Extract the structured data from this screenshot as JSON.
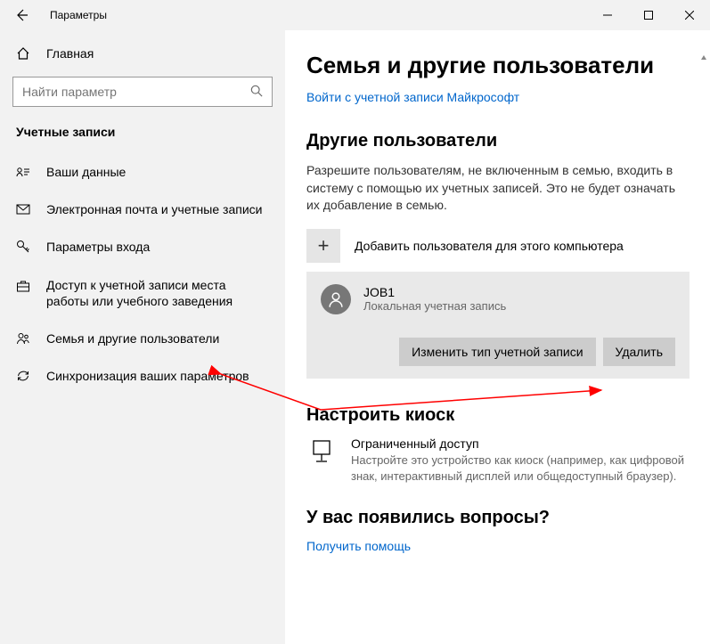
{
  "window": {
    "title": "Параметры"
  },
  "sidebar": {
    "home": "Главная",
    "searchPlaceholder": "Найти параметр",
    "category": "Учетные записи",
    "items": [
      {
        "label": "Ваши данные"
      },
      {
        "label": "Электронная почта и учетные записи"
      },
      {
        "label": "Параметры входа"
      },
      {
        "label": "Доступ к учетной записи места работы или учебного заведения"
      },
      {
        "label": "Семья и другие пользователи"
      },
      {
        "label": "Синхронизация ваших параметров"
      }
    ]
  },
  "main": {
    "pageTitle": "Семья и другие пользователи",
    "signInLink": "Войти с учетной записи Майкрософт",
    "otherUsers": {
      "title": "Другие пользователи",
      "desc": "Разрешите пользователям, не включенным в семью, входить в систему с помощью их учетных записей. Это не будет означать их добавление в семью.",
      "addLabel": "Добавить пользователя для этого компьютера"
    },
    "user": {
      "name": "JOB1",
      "sub": "Локальная учетная запись",
      "changeTypeBtn": "Изменить тип учетной записи",
      "deleteBtn": "Удалить"
    },
    "kiosk": {
      "title": "Настроить киоск",
      "itemTitle": "Ограниченный доступ",
      "itemDesc": "Настройте это устройство как киоск (например, как цифровой знак, интерактивный дисплей или общедоступный браузер)."
    },
    "help": {
      "title": "У вас появились вопросы?",
      "link": "Получить помощь"
    }
  }
}
